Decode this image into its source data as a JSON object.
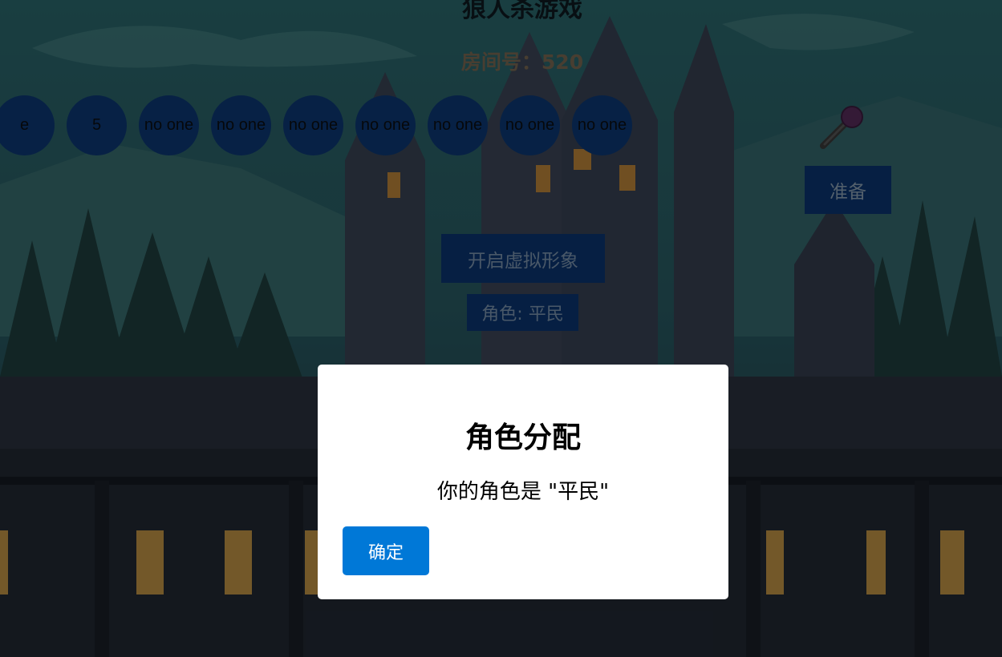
{
  "header": {
    "title": "狼人杀游戏",
    "room_label": "房间号：",
    "room_number": "520"
  },
  "seats": [
    {
      "label": "e"
    },
    {
      "label": "5"
    },
    {
      "label": "no one"
    },
    {
      "label": "no one"
    },
    {
      "label": "no one"
    },
    {
      "label": "no one"
    },
    {
      "label": "no one"
    },
    {
      "label": "no one"
    },
    {
      "label": "no one"
    }
  ],
  "controls": {
    "ready_label": "准备",
    "avatar_label": "开启虚拟形象",
    "role_badge": "角色: 平民",
    "mic_icon": "microphone-icon"
  },
  "modal": {
    "title": "角色分配",
    "message": "你的角色是 \"平民\"",
    "ok_label": "确定"
  },
  "colors": {
    "seat_bg": "#0d3a78",
    "button_bg": "#0b3674",
    "modal_ok_bg": "#0078d7",
    "room_text": "#7d6b55"
  }
}
